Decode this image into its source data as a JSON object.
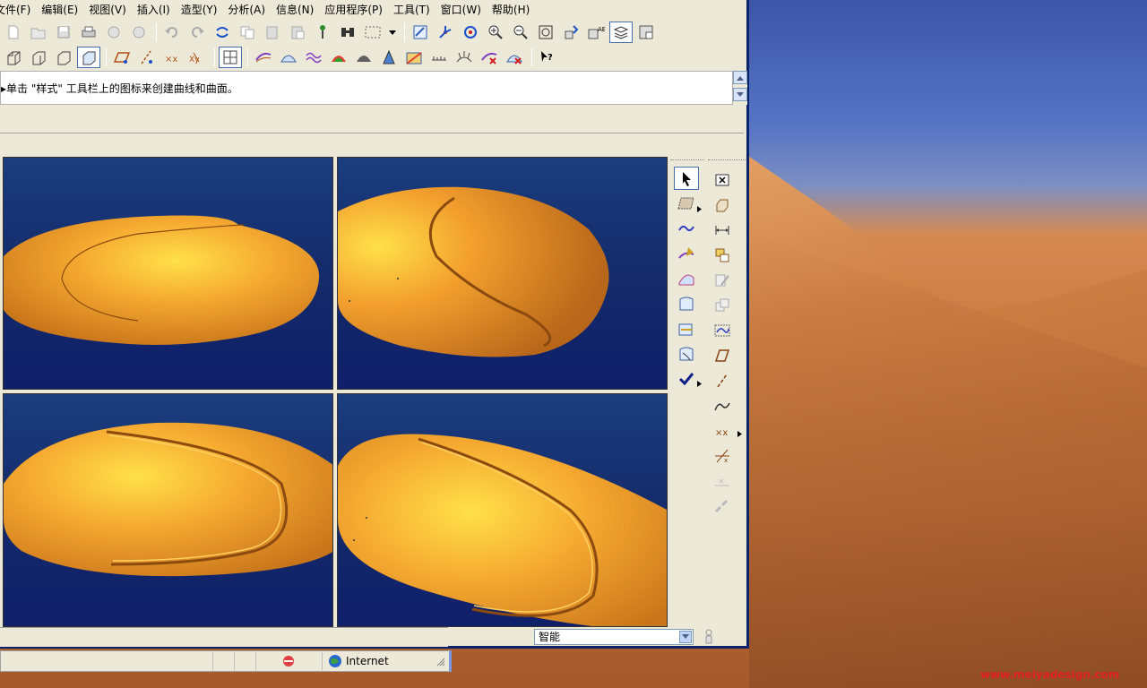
{
  "menu": [
    {
      "label": "文件(F)",
      "name": "menu-file"
    },
    {
      "label": "编辑(E)",
      "name": "menu-edit"
    },
    {
      "label": "视图(V)",
      "name": "menu-view"
    },
    {
      "label": "插入(I)",
      "name": "menu-insert"
    },
    {
      "label": "造型(Y)",
      "name": "menu-modeling"
    },
    {
      "label": "分析(A)",
      "name": "menu-analysis"
    },
    {
      "label": "信息(N)",
      "name": "menu-info"
    },
    {
      "label": "应用程序(P)",
      "name": "menu-applications"
    },
    {
      "label": "工具(T)",
      "name": "menu-tools"
    },
    {
      "label": "窗口(W)",
      "name": "menu-window"
    },
    {
      "label": "帮助(H)",
      "name": "menu-help"
    }
  ],
  "prompt": {
    "message": "▸单击 \"样式\" 工具栏上的图标来创建曲线和曲面。"
  },
  "filter": {
    "selected": "智能"
  },
  "ie_status": {
    "zone": "Internet"
  },
  "watermark": "www.meiyadesign.com",
  "colors": {
    "viewport_bg": "#142b6a",
    "model": "#f0a030",
    "titlebar_border": "#0a246a"
  }
}
